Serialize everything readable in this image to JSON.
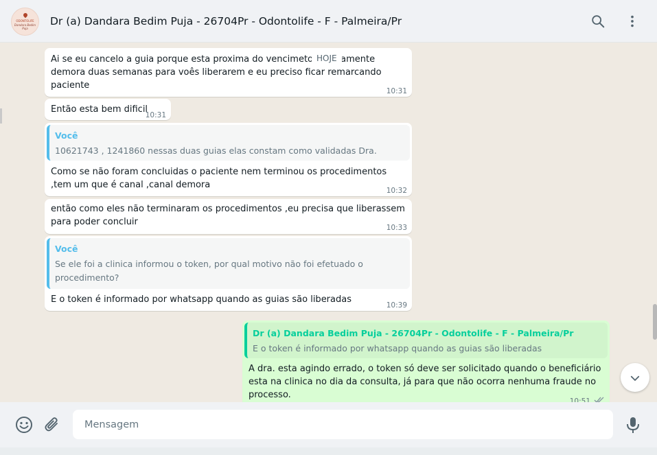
{
  "header": {
    "title": "Dr (a) Dandara Bedim Puja - 26704Pr - Odontolife - F - Palmeira/Pr",
    "avatar_lines": [
      "ODONTOLIFE",
      "Dandara Bedim Puja"
    ]
  },
  "date_chip": "HOJE",
  "messages": [
    {
      "text": "Ai se eu cancelo a guia porque esta proxima do vencimeto e novamente demora duas semanas para voês liberarem e eu preciso ficar remarcando paciente",
      "time": "10:31"
    },
    {
      "text": "Então esta bem dificil",
      "time": "10:31"
    },
    {
      "quote": {
        "author": "Você",
        "text": "10621743 , 1241860  nessas duas guias elas constam como validadas Dra."
      },
      "text": "Como se não foram concluidas o paciente nem terminou os procedimentos ,tem um que é canal ,canal demora",
      "time": "10:32"
    },
    {
      "text": "então como eles não terminaram os procedimentos ,eu precisa que liberassem para poder concluir",
      "time": "10:33"
    },
    {
      "quote": {
        "author": "Você",
        "text": "Se ele foi a clinica informou o token, por qual motivo não foi efetuado o procedimento?"
      },
      "text": "E o token é informado por whatsapp quando as guias são liberadas",
      "time": "10:39"
    },
    {
      "quote": {
        "author": "Dr (a) Dandara Bedim Puja - 26704Pr - Odontolife - F - Palmeira/Pr",
        "text": "E o token é informado por whatsapp quando as guias são liberadas"
      },
      "text": "A dra. esta agindo errado, o token só deve ser solicitado quando o beneficiário esta na clinica no dia da consulta, já para que não ocorra nenhuma fraude no processo.",
      "time": "10:51"
    }
  ],
  "composer": {
    "placeholder": "Mensagem",
    "value": ""
  },
  "icons": {
    "search": "search-icon",
    "menu": "kebab-menu-icon",
    "emoji": "emoji-icon",
    "attach": "paperclip-icon",
    "mic": "microphone-icon",
    "scroll_down": "chevron-down-icon",
    "read_receipt": "double-check-icon"
  }
}
